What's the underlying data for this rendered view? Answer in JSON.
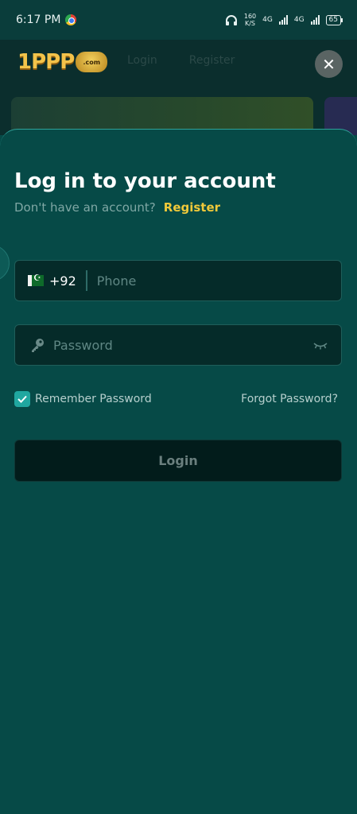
{
  "status_bar": {
    "time": "6:17 PM",
    "net_speed_value": "160",
    "net_speed_unit": "K/S",
    "network_1": "4G",
    "network_2": "4G",
    "battery": "65"
  },
  "background": {
    "logo_text": "1PPP",
    "logo_badge": ".com",
    "tabs": [
      "Login",
      "Register"
    ]
  },
  "login": {
    "title": "Log in to your account",
    "no_account_text": "Don't have an account?",
    "register_label": "Register",
    "country_code": "+92",
    "phone_placeholder": "Phone",
    "password_placeholder": "Password",
    "remember_label": "Remember Password",
    "remember_checked": true,
    "forgot_label": "Forgot Password?",
    "login_button": "Login"
  },
  "colors": {
    "sheet_bg": "#064a47",
    "accent_yellow": "#f0c93a",
    "checkbox_teal": "#20a7a0"
  }
}
